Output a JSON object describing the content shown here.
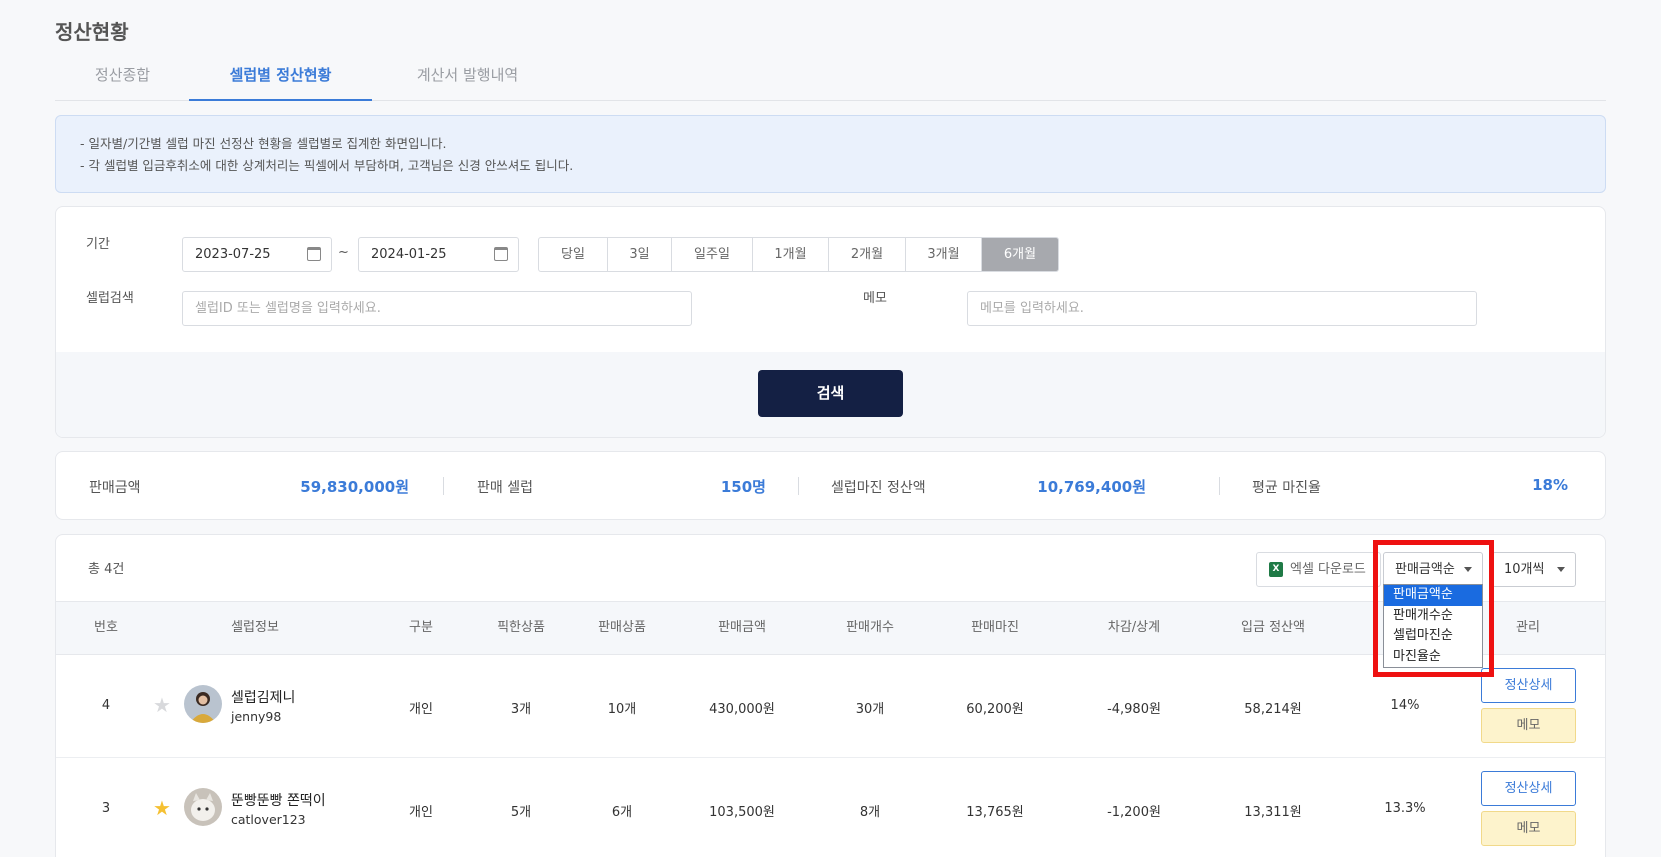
{
  "page": {
    "title": "정산현황"
  },
  "tabs": [
    {
      "label": "정산종합"
    },
    {
      "label": "셀럽별 정산현황"
    },
    {
      "label": "계산서 발행내역"
    }
  ],
  "notice": {
    "lines": [
      "-  일자별/기간별 셀럽 마진 선정산 현황을 셀럽별로 집계한 화면입니다.",
      "-  각 셀럽별 입금후취소에 대한 상계처리는 픽셀에서 부담하며, 고객님은 신경 안쓰셔도 됩니다."
    ]
  },
  "search": {
    "period_label": "기간",
    "start_date": "2023-07-25",
    "end_date": "2024-01-25",
    "tilde": "~",
    "period_buttons": [
      "당일",
      "3일",
      "일주일",
      "1개월",
      "2개월",
      "3개월",
      "6개월"
    ],
    "active_period": "6개월",
    "celeb_label": "셀럽검색",
    "celeb_placeholder": "셀럽ID 또는 셀럽명을 입력하세요.",
    "memo_label": "메모",
    "memo_placeholder": "메모를 입력하세요.",
    "search_button": "검색"
  },
  "summary": {
    "sales_label": "판매금액",
    "sales_value": "59,830,000원",
    "celeb_label": "판매 셀럽",
    "celeb_value": "150명",
    "margin_label": "셀럽마진 정산액",
    "margin_value": "10,769,400원",
    "rate_label": "평균 마진율",
    "rate_value": "18%"
  },
  "list": {
    "total": "총 4건",
    "excel_button": "엑셀 다운로드",
    "excel_icon_text": "X",
    "sort_select": "판매금액순",
    "page_size_select": "10개씩",
    "sort_options": [
      "판매금액순",
      "판매개수순",
      "셀럽마진순",
      "마진율순"
    ],
    "columns": [
      "번호",
      "셀럽정보",
      "구분",
      "픽한상품",
      "판매상품",
      "판매금액",
      "판매개수",
      "판매마진",
      "차감/상계",
      "입금 정산액",
      "관리"
    ],
    "rows": [
      {
        "no": "4",
        "starred": false,
        "name": "셀럽김제니",
        "id": "jenny98",
        "type": "개인",
        "picked": "3개",
        "sold": "10개",
        "amount": "430,000원",
        "count": "30개",
        "margin": "60,200원",
        "deduct": "-4,980원",
        "deposit": "58,214원",
        "rate": "14%",
        "detail_button": "정산상세",
        "memo_button": "메모",
        "star_glyph": "★"
      },
      {
        "no": "3",
        "starred": true,
        "name": "뚠빵뚠빵 쫀떡이",
        "id": "catlover123",
        "type": "개인",
        "picked": "5개",
        "sold": "6개",
        "amount": "103,500원",
        "count": "8개",
        "margin": "13,765원",
        "deduct": "-1,200원",
        "deposit": "13,311원",
        "rate": "13.3%",
        "detail_button": "정산상세",
        "memo_button": "메모",
        "star_glyph": "★"
      }
    ]
  },
  "colors": {
    "accent": "#3b7bd8",
    "navy": "#142044",
    "highlight": "#ee1111",
    "star_on": "#f5c032",
    "star_off": "#d8d9dc"
  }
}
